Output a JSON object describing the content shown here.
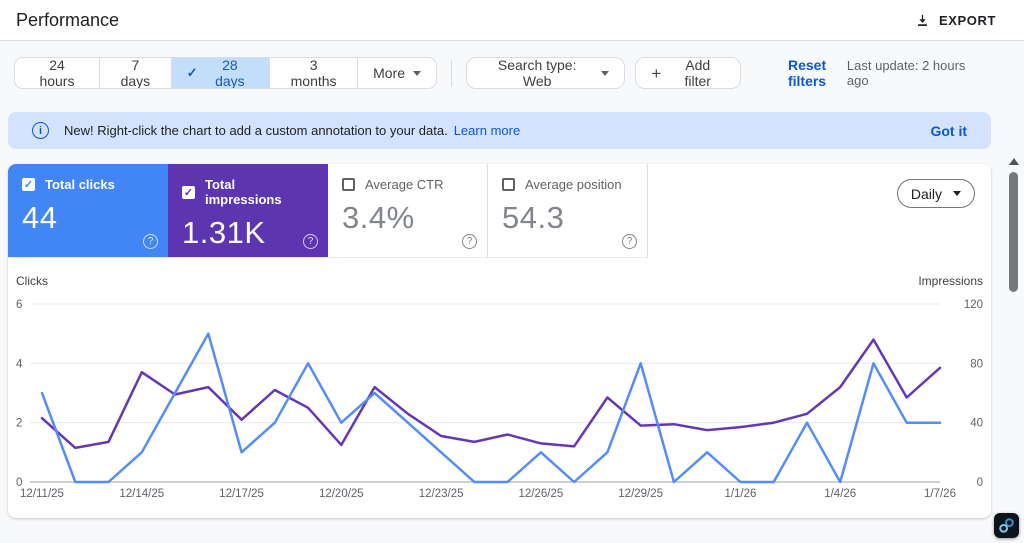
{
  "header": {
    "title": "Performance",
    "export_label": "EXPORT"
  },
  "filters": {
    "date_ranges": [
      {
        "label": "24 hours",
        "selected": false
      },
      {
        "label": "7 days",
        "selected": false
      },
      {
        "label": "28 days",
        "selected": true
      },
      {
        "label": "3 months",
        "selected": false
      },
      {
        "label": "More",
        "selected": false
      }
    ],
    "search_type_label": "Search type: Web",
    "add_filter_label": "Add filter",
    "reset_filters_label": "Reset filters",
    "last_update": "Last update: 2 hours ago"
  },
  "banner": {
    "message": "New! Right-click the chart to add a custom annotation to your data.",
    "learn_more_label": "Learn more",
    "dismiss_label": "Got it"
  },
  "metrics": {
    "cards": [
      {
        "label": "Total clicks",
        "value": "44",
        "checked": true,
        "color": "#4285f4"
      },
      {
        "label": "Total impressions",
        "value": "1.31K",
        "checked": true,
        "color": "#5e35b1"
      },
      {
        "label": "Average CTR",
        "value": "3.4%",
        "checked": false
      },
      {
        "label": "Average position",
        "value": "54.3",
        "checked": false
      }
    ],
    "granularity": "Daily"
  },
  "chart_data": {
    "type": "line",
    "x": [
      "12/11/25",
      "12/12/25",
      "12/13/25",
      "12/14/25",
      "12/15/25",
      "12/16/25",
      "12/17/25",
      "12/18/25",
      "12/19/25",
      "12/20/25",
      "12/21/25",
      "12/22/25",
      "12/23/25",
      "12/24/25",
      "12/25/25",
      "12/26/25",
      "12/27/25",
      "12/28/25",
      "12/29/25",
      "12/30/25",
      "12/31/25",
      "1/1/26",
      "1/2/26",
      "1/3/26",
      "1/4/26",
      "1/5/26",
      "1/6/26",
      "1/7/26"
    ],
    "x_tick_labels": [
      "12/11/25",
      "12/14/25",
      "12/17/25",
      "12/20/25",
      "12/23/25",
      "12/26/25",
      "12/29/25",
      "1/1/26",
      "1/4/26",
      "1/7/26"
    ],
    "series": [
      {
        "name": "Clicks",
        "axis": "left",
        "color": "#548df7",
        "values": [
          3,
          0,
          0,
          1,
          3,
          5,
          1,
          2,
          4,
          2,
          3,
          2,
          1,
          0,
          0,
          1,
          0,
          1,
          4,
          0,
          1,
          0,
          0,
          2,
          0,
          4,
          2,
          2
        ]
      },
      {
        "name": "Impressions",
        "axis": "right",
        "color": "#6637b5",
        "values": [
          43,
          23,
          27,
          74,
          59,
          64,
          42,
          62,
          50,
          25,
          64,
          46,
          31,
          27,
          32,
          26,
          24,
          57,
          38,
          39,
          35,
          37,
          40,
          46,
          64,
          96,
          57,
          77
        ]
      }
    ],
    "left_axis": {
      "label": "Clicks",
      "ticks": [
        0,
        2,
        4,
        6
      ],
      "max": 6
    },
    "right_axis": {
      "label": "Impressions",
      "ticks": [
        0,
        40,
        80,
        120
      ],
      "max": 120
    },
    "grid": true,
    "legend_position": "none",
    "grid_color": "#e8eaed",
    "baseline_color": "#9aa0a6",
    "tick_color": "#5f6368"
  }
}
